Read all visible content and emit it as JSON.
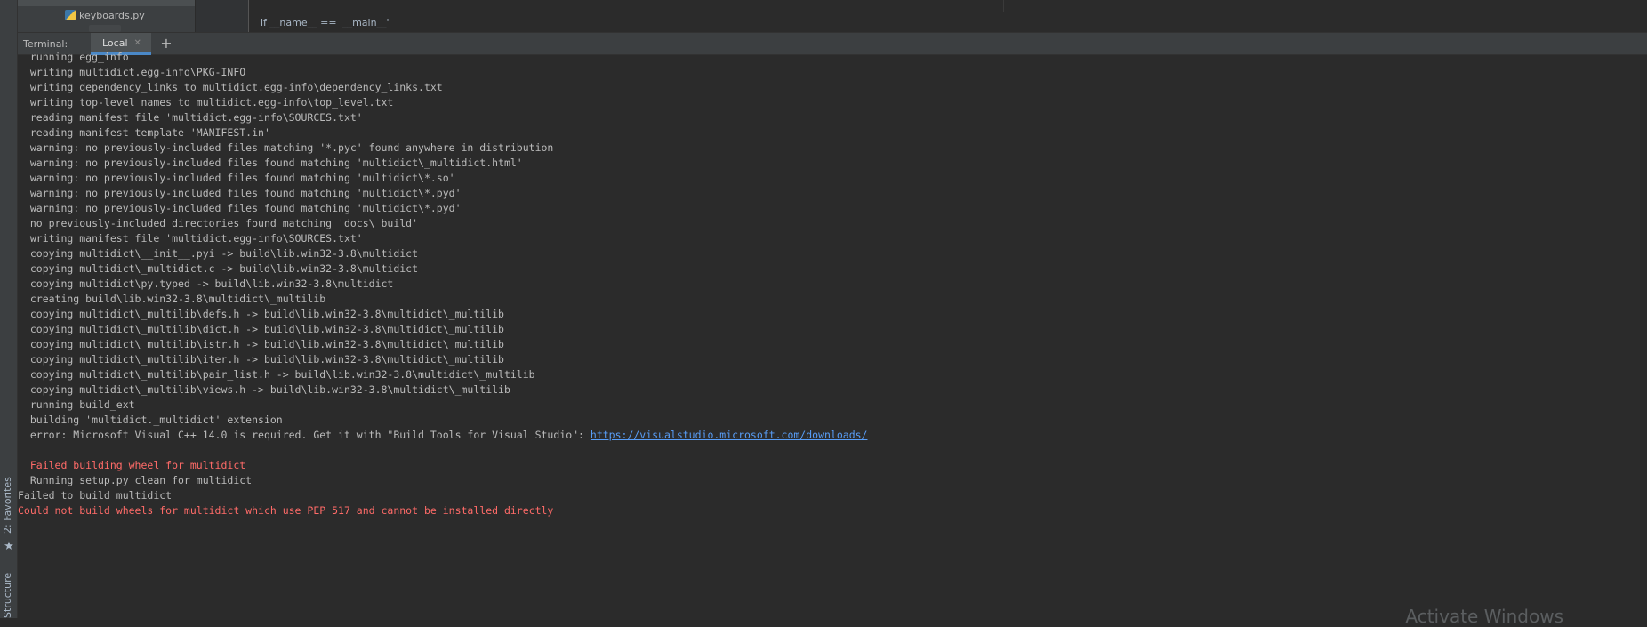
{
  "side_tabs": {
    "favorites": "2: Favorites",
    "structure": "Structure"
  },
  "project": {
    "file": "keyboards.py"
  },
  "editor": {
    "prev_line": "...",
    "line": "if __name__ == '__main__'"
  },
  "terminal": {
    "title": "Terminal:",
    "tab_label": "Local",
    "lines": [
      {
        "text": "  running egg_info",
        "style": "normal"
      },
      {
        "text": "  writing multidict.egg-info\\PKG-INFO",
        "style": "normal"
      },
      {
        "text": "  writing dependency_links to multidict.egg-info\\dependency_links.txt",
        "style": "normal"
      },
      {
        "text": "  writing top-level names to multidict.egg-info\\top_level.txt",
        "style": "normal"
      },
      {
        "text": "  reading manifest file 'multidict.egg-info\\SOURCES.txt'",
        "style": "normal"
      },
      {
        "text": "  reading manifest template 'MANIFEST.in'",
        "style": "normal"
      },
      {
        "text": "  warning: no previously-included files matching '*.pyc' found anywhere in distribution",
        "style": "normal"
      },
      {
        "text": "  warning: no previously-included files found matching 'multidict\\_multidict.html'",
        "style": "normal"
      },
      {
        "text": "  warning: no previously-included files found matching 'multidict\\*.so'",
        "style": "normal"
      },
      {
        "text": "  warning: no previously-included files found matching 'multidict\\*.pyd'",
        "style": "normal"
      },
      {
        "text": "  warning: no previously-included files found matching 'multidict\\*.pyd'",
        "style": "normal"
      },
      {
        "text": "  no previously-included directories found matching 'docs\\_build'",
        "style": "normal"
      },
      {
        "text": "  writing manifest file 'multidict.egg-info\\SOURCES.txt'",
        "style": "normal"
      },
      {
        "text": "  copying multidict\\__init__.pyi -> build\\lib.win32-3.8\\multidict",
        "style": "normal"
      },
      {
        "text": "  copying multidict\\_multidict.c -> build\\lib.win32-3.8\\multidict",
        "style": "normal"
      },
      {
        "text": "  copying multidict\\py.typed -> build\\lib.win32-3.8\\multidict",
        "style": "normal"
      },
      {
        "text": "  creating build\\lib.win32-3.8\\multidict\\_multilib",
        "style": "normal"
      },
      {
        "text": "  copying multidict\\_multilib\\defs.h -> build\\lib.win32-3.8\\multidict\\_multilib",
        "style": "normal"
      },
      {
        "text": "  copying multidict\\_multilib\\dict.h -> build\\lib.win32-3.8\\multidict\\_multilib",
        "style": "normal"
      },
      {
        "text": "  copying multidict\\_multilib\\istr.h -> build\\lib.win32-3.8\\multidict\\_multilib",
        "style": "normal"
      },
      {
        "text": "  copying multidict\\_multilib\\iter.h -> build\\lib.win32-3.8\\multidict\\_multilib",
        "style": "normal"
      },
      {
        "text": "  copying multidict\\_multilib\\pair_list.h -> build\\lib.win32-3.8\\multidict\\_multilib",
        "style": "normal"
      },
      {
        "text": "  copying multidict\\_multilib\\views.h -> build\\lib.win32-3.8\\multidict\\_multilib",
        "style": "normal"
      },
      {
        "text": "  running build_ext",
        "style": "normal"
      },
      {
        "text": "  building 'multidict._multidict' extension",
        "style": "normal"
      },
      {
        "text": "  error: Microsoft Visual C++ 14.0 is required. Get it with \"Build Tools for Visual Studio\": ",
        "style": "normal",
        "link": "https://visualstudio.microsoft.com/downloads/"
      },
      {
        "text": "",
        "style": "normal"
      },
      {
        "text": "  Failed building wheel for multidict",
        "style": "red"
      },
      {
        "text": "  Running setup.py clean for multidict",
        "style": "normal"
      },
      {
        "text": "Failed to build multidict",
        "style": "normal"
      },
      {
        "text": "Could not build wheels for multidict which use PEP 517 and cannot be installed directly",
        "style": "red"
      }
    ]
  },
  "watermark": "Activate Windows"
}
